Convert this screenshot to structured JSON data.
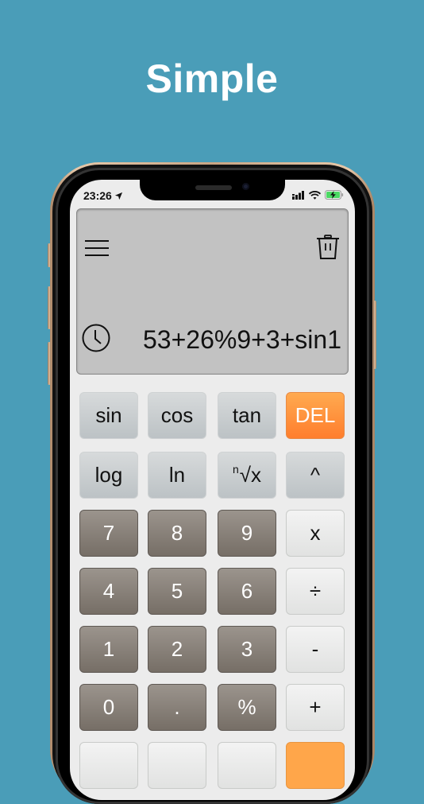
{
  "headline": "Simple",
  "status_bar": {
    "time": "23:26",
    "icons": [
      "location-arrow-icon",
      "cellular-signal-icon",
      "wifi-icon",
      "battery-charging-icon"
    ],
    "battery_color": "#4cd964"
  },
  "display": {
    "menu_icon": "hamburger-menu-icon",
    "trash_icon": "trash-icon",
    "history_icon": "clock-icon",
    "expression": "53+26%9+3+sin1"
  },
  "keypad": {
    "rows": [
      [
        {
          "label": "sin",
          "type": "function"
        },
        {
          "label": "cos",
          "type": "function"
        },
        {
          "label": "tan",
          "type": "function"
        },
        {
          "label": "DEL",
          "type": "delete"
        }
      ],
      [
        {
          "label": "log",
          "type": "function"
        },
        {
          "label": "ln",
          "type": "function"
        },
        {
          "label": "√x",
          "superscript": "n",
          "type": "function"
        },
        {
          "label": "^",
          "type": "function"
        }
      ],
      [
        {
          "label": "7",
          "type": "number"
        },
        {
          "label": "8",
          "type": "number"
        },
        {
          "label": "9",
          "type": "number"
        },
        {
          "label": "x",
          "type": "operator"
        }
      ],
      [
        {
          "label": "4",
          "type": "number"
        },
        {
          "label": "5",
          "type": "number"
        },
        {
          "label": "6",
          "type": "number"
        },
        {
          "label": "÷",
          "type": "operator"
        }
      ],
      [
        {
          "label": "1",
          "type": "number"
        },
        {
          "label": "2",
          "type": "number"
        },
        {
          "label": "3",
          "type": "number"
        },
        {
          "label": "-",
          "type": "operator"
        }
      ],
      [
        {
          "label": "0",
          "type": "number"
        },
        {
          "label": ".",
          "type": "number"
        },
        {
          "label": "%",
          "type": "number"
        },
        {
          "label": "+",
          "type": "operator"
        }
      ],
      [
        {
          "label": "",
          "type": "operator"
        },
        {
          "label": "",
          "type": "operator"
        },
        {
          "label": "",
          "type": "operator"
        },
        {
          "label": "",
          "type": "equals"
        }
      ]
    ]
  },
  "colors": {
    "background": "#4a9db8",
    "delete_key": "#ff8a35",
    "number_key": "#847c74",
    "display_bg": "#c2c2c2"
  }
}
